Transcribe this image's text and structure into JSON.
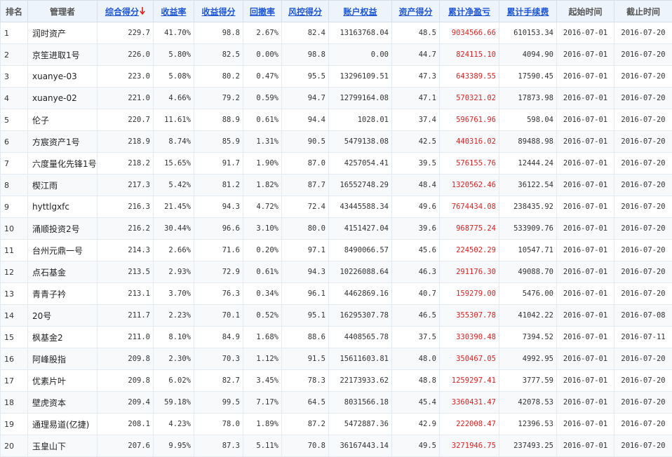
{
  "columns": [
    {
      "label": "排名",
      "sortable": false
    },
    {
      "label": "管理者",
      "sortable": false
    },
    {
      "label": "综合得分",
      "sortable": true,
      "sorted": "desc",
      "sort_icon": "arrow-down-icon"
    },
    {
      "label": "收益率",
      "sortable": true
    },
    {
      "label": "收益得分",
      "sortable": true
    },
    {
      "label": "回撤率",
      "sortable": true
    },
    {
      "label": "风控得分",
      "sortable": true
    },
    {
      "label": "账户权益",
      "sortable": true
    },
    {
      "label": "资产得分",
      "sortable": true
    },
    {
      "label": "累计净盈亏",
      "sortable": true
    },
    {
      "label": "累计手续费",
      "sortable": true
    },
    {
      "label": "起始时间",
      "sortable": false
    },
    {
      "label": "截止时间",
      "sortable": false
    }
  ],
  "colors": {
    "profit_text": "#e02020",
    "link": "#1f56d6",
    "header_bg": "#eef4fb"
  },
  "rows": [
    {
      "rank": "1",
      "manager": "润时资产",
      "score": "229.7",
      "return_rate": "41.70%",
      "return_score": "98.8",
      "drawdown": "2.67%",
      "risk_score": "82.4",
      "equity": "13163768.04",
      "asset_score": "48.5",
      "net_pnl": "9034566.66",
      "fees": "610153.34",
      "start": "2016-07-01",
      "end": "2016-07-20"
    },
    {
      "rank": "2",
      "manager": "京笙进取1号",
      "score": "226.0",
      "return_rate": "5.80%",
      "return_score": "82.5",
      "drawdown": "0.00%",
      "risk_score": "98.8",
      "equity": "0.00",
      "asset_score": "44.7",
      "net_pnl": "824115.10",
      "fees": "4094.90",
      "start": "2016-07-01",
      "end": "2016-07-20"
    },
    {
      "rank": "3",
      "manager": "xuanye-03",
      "score": "223.0",
      "return_rate": "5.08%",
      "return_score": "80.2",
      "drawdown": "0.47%",
      "risk_score": "95.5",
      "equity": "13296109.51",
      "asset_score": "47.3",
      "net_pnl": "643389.55",
      "fees": "17590.45",
      "start": "2016-07-01",
      "end": "2016-07-20"
    },
    {
      "rank": "4",
      "manager": "xuanye-02",
      "score": "221.0",
      "return_rate": "4.66%",
      "return_score": "79.2",
      "drawdown": "0.59%",
      "risk_score": "94.7",
      "equity": "12799164.08",
      "asset_score": "47.1",
      "net_pnl": "570321.02",
      "fees": "17873.98",
      "start": "2016-07-01",
      "end": "2016-07-20"
    },
    {
      "rank": "5",
      "manager": "伦子",
      "score": "220.7",
      "return_rate": "11.61%",
      "return_score": "88.9",
      "drawdown": "0.61%",
      "risk_score": "94.4",
      "equity": "1028.01",
      "asset_score": "37.4",
      "net_pnl": "596761.96",
      "fees": "598.04",
      "start": "2016-07-01",
      "end": "2016-07-20"
    },
    {
      "rank": "6",
      "manager": "方宸资产1号",
      "score": "218.9",
      "return_rate": "8.74%",
      "return_score": "85.9",
      "drawdown": "1.31%",
      "risk_score": "90.5",
      "equity": "5479138.08",
      "asset_score": "42.5",
      "net_pnl": "440316.02",
      "fees": "89488.98",
      "start": "2016-07-01",
      "end": "2016-07-20"
    },
    {
      "rank": "7",
      "manager": "六度量化先锋1号",
      "score": "218.2",
      "return_rate": "15.65%",
      "return_score": "91.7",
      "drawdown": "1.90%",
      "risk_score": "87.0",
      "equity": "4257054.41",
      "asset_score": "39.5",
      "net_pnl": "576155.76",
      "fees": "12444.24",
      "start": "2016-07-01",
      "end": "2016-07-20"
    },
    {
      "rank": "8",
      "manager": "楔江雨",
      "score": "217.3",
      "return_rate": "5.42%",
      "return_score": "81.2",
      "drawdown": "1.82%",
      "risk_score": "87.7",
      "equity": "16552748.29",
      "asset_score": "48.4",
      "net_pnl": "1320562.46",
      "fees": "36122.54",
      "start": "2016-07-01",
      "end": "2016-07-20"
    },
    {
      "rank": "9",
      "manager": "hyttlgxfc",
      "score": "216.3",
      "return_rate": "21.45%",
      "return_score": "94.3",
      "drawdown": "4.72%",
      "risk_score": "72.4",
      "equity": "43445588.34",
      "asset_score": "49.6",
      "net_pnl": "7674434.08",
      "fees": "238435.92",
      "start": "2016-07-01",
      "end": "2016-07-20"
    },
    {
      "rank": "10",
      "manager": "涌顺投资2号",
      "score": "216.2",
      "return_rate": "30.44%",
      "return_score": "96.6",
      "drawdown": "3.10%",
      "risk_score": "80.0",
      "equity": "4151427.04",
      "asset_score": "39.6",
      "net_pnl": "968775.24",
      "fees": "533909.76",
      "start": "2016-07-01",
      "end": "2016-07-20"
    },
    {
      "rank": "11",
      "manager": "台州元鼎一号",
      "score": "214.3",
      "return_rate": "2.66%",
      "return_score": "71.6",
      "drawdown": "0.20%",
      "risk_score": "97.1",
      "equity": "8490066.57",
      "asset_score": "45.6",
      "net_pnl": "224502.29",
      "fees": "10547.71",
      "start": "2016-07-01",
      "end": "2016-07-20"
    },
    {
      "rank": "12",
      "manager": "点石基金",
      "score": "213.5",
      "return_rate": "2.93%",
      "return_score": "72.9",
      "drawdown": "0.61%",
      "risk_score": "94.3",
      "equity": "10226088.64",
      "asset_score": "46.3",
      "net_pnl": "291176.30",
      "fees": "49088.70",
      "start": "2016-07-01",
      "end": "2016-07-20"
    },
    {
      "rank": "13",
      "manager": "青青子衿",
      "score": "213.1",
      "return_rate": "3.70%",
      "return_score": "76.3",
      "drawdown": "0.34%",
      "risk_score": "96.1",
      "equity": "4462869.16",
      "asset_score": "40.7",
      "net_pnl": "159279.00",
      "fees": "5476.00",
      "start": "2016-07-01",
      "end": "2016-07-20"
    },
    {
      "rank": "14",
      "manager": "20号",
      "score": "211.7",
      "return_rate": "2.23%",
      "return_score": "70.1",
      "drawdown": "0.52%",
      "risk_score": "95.1",
      "equity": "16295307.78",
      "asset_score": "46.5",
      "net_pnl": "355307.78",
      "fees": "41042.22",
      "start": "2016-07-01",
      "end": "2016-07-08"
    },
    {
      "rank": "15",
      "manager": "枫基金2",
      "score": "211.0",
      "return_rate": "8.10%",
      "return_score": "84.9",
      "drawdown": "1.68%",
      "risk_score": "88.6",
      "equity": "4408565.78",
      "asset_score": "37.5",
      "net_pnl": "330390.48",
      "fees": "7394.52",
      "start": "2016-07-01",
      "end": "2016-07-11"
    },
    {
      "rank": "16",
      "manager": "阿峰股指",
      "score": "209.8",
      "return_rate": "2.30%",
      "return_score": "70.3",
      "drawdown": "1.12%",
      "risk_score": "91.5",
      "equity": "15611603.81",
      "asset_score": "48.0",
      "net_pnl": "350467.05",
      "fees": "4992.95",
      "start": "2016-07-01",
      "end": "2016-07-20"
    },
    {
      "rank": "17",
      "manager": "优素片叶",
      "score": "209.8",
      "return_rate": "6.02%",
      "return_score": "82.7",
      "drawdown": "3.45%",
      "risk_score": "78.3",
      "equity": "22173933.62",
      "asset_score": "48.8",
      "net_pnl": "1259297.41",
      "fees": "3777.59",
      "start": "2016-07-01",
      "end": "2016-07-20"
    },
    {
      "rank": "18",
      "manager": "壁虎资本",
      "score": "209.4",
      "return_rate": "59.18%",
      "return_score": "99.5",
      "drawdown": "7.17%",
      "risk_score": "64.5",
      "equity": "8031566.18",
      "asset_score": "45.4",
      "net_pnl": "3360431.47",
      "fees": "42078.53",
      "start": "2016-07-01",
      "end": "2016-07-20"
    },
    {
      "rank": "19",
      "manager": "通理易道(亿捷)",
      "score": "208.1",
      "return_rate": "4.23%",
      "return_score": "78.0",
      "drawdown": "1.89%",
      "risk_score": "87.2",
      "equity": "5472887.36",
      "asset_score": "42.9",
      "net_pnl": "222008.47",
      "fees": "12396.53",
      "start": "2016-07-01",
      "end": "2016-07-20"
    },
    {
      "rank": "20",
      "manager": "玉皇山下",
      "score": "207.6",
      "return_rate": "9.95%",
      "return_score": "87.3",
      "drawdown": "5.11%",
      "risk_score": "70.8",
      "equity": "36167443.14",
      "asset_score": "49.5",
      "net_pnl": "3271946.75",
      "fees": "237493.25",
      "start": "2016-07-01",
      "end": "2016-07-20"
    }
  ]
}
